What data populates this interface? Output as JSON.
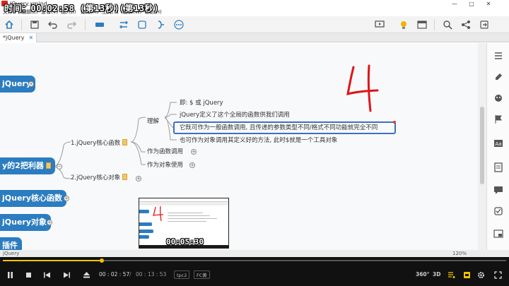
{
  "window": {
    "title": "jQuery.xmind",
    "minimize": "—",
    "maximize": "□",
    "close": "✕"
  },
  "overlay_timestamp": "时间：00:02:58 (第13秒)(第13秒)",
  "menu": [
    {
      "label": "文件(F)"
    },
    {
      "label": "编辑(E)"
    },
    {
      "label": "查看(V)"
    },
    {
      "label": "插入(I)"
    },
    {
      "label": "修改(M)"
    },
    {
      "label": "工具(T)"
    },
    {
      "label": "窗口(W)"
    },
    {
      "label": "帮助(H)"
    }
  ],
  "tab": {
    "label": "*jQuery",
    "close": "✕"
  },
  "mindmap": {
    "root_nodes": [
      {
        "label": "jQuery"
      },
      {
        "label": "y的2把利器"
      },
      {
        "label": "jQuery核心函数"
      },
      {
        "label": "jQuery对象"
      },
      {
        "label": "插件"
      }
    ],
    "branch_1": "1.jQuery核心函数",
    "branch_2": "2.jQuery核心对象",
    "understand": "理解",
    "use_as_function": "作为函数调用",
    "use_as_object": "作为对象使用",
    "details": [
      "即: $ 或 jQuery",
      "jQuery定义了这个全局的函数供我们调用",
      "它既可作为一般函数调用, 且传递的参数类型不同/格式不同功能就完全不同",
      "也可作为对象调用其定义好的方法, 此时$就是一个工具对象"
    ],
    "handwriting": "4"
  },
  "statusbar": {
    "left": "jQuery",
    "zoom": "120%"
  },
  "player": {
    "progress": 0.196,
    "current_time": "00 : 02 : 57",
    "separator": "/",
    "total_time": "00 : 13 : 53",
    "tag1": "tpc2",
    "tag2": "FC黄",
    "preview_time": "00:05:30",
    "btn_360": "360°",
    "btn_3d": "3D",
    "accent": "#f2c200"
  }
}
